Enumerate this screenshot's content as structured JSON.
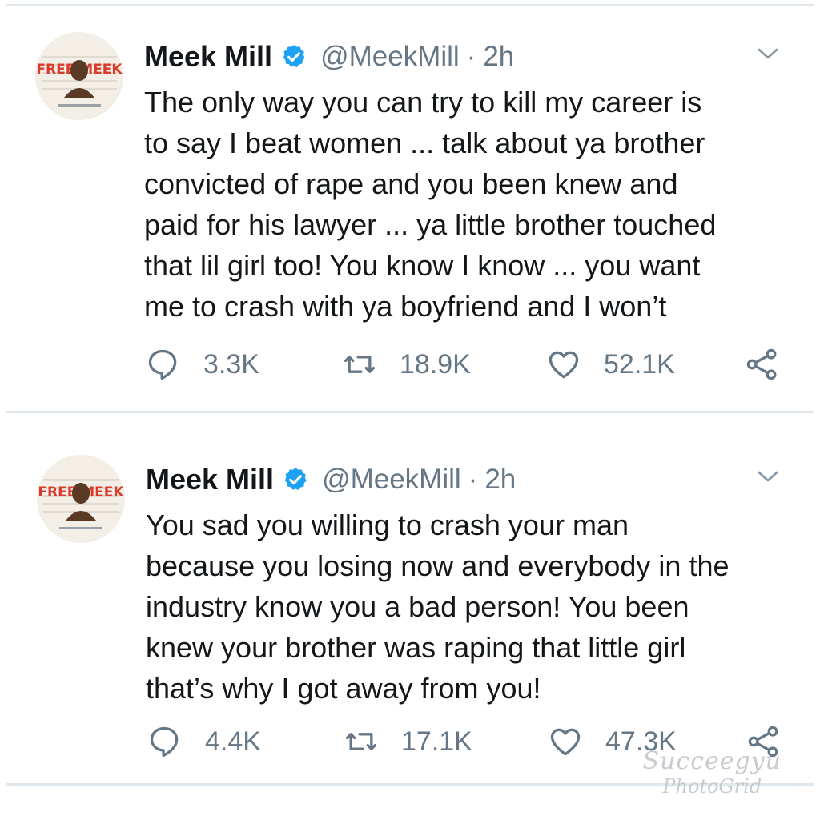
{
  "tweets": [
    {
      "name": "Meek Mill",
      "handle": "@MeekMill",
      "separator": "·",
      "time": "2h",
      "text": "The only way you can try to kill my career is\nto say I beat women ... talk about ya brother\nconvicted of rape and you been knew and\npaid for his lawyer ... ya little brother touched\nthat lil girl too! You know I know ... you want\nme to crash with ya boyfriend and I won’t",
      "replies": "3.3K",
      "retweets": "18.9K",
      "likes": "52.1K",
      "avatar_text": "FREE MEEK"
    },
    {
      "name": "Meek Mill",
      "handle": "@MeekMill",
      "separator": "·",
      "time": "2h",
      "text": "You sad you willing to crash your man\nbecause you losing now and everybody in the\nindustry know you a bad person! You been\nknew your brother was raping that little girl\nthat’s why I got away from you!",
      "replies": "4.4K",
      "retweets": "17.1K",
      "likes": "47.3K",
      "avatar_text": "FREE MEEK"
    }
  ],
  "watermark": {
    "line1": "Succeegyu",
    "line2": "PhotoGrid"
  },
  "colors": {
    "verified": "#1da1f2",
    "muted": "#657786",
    "text": "#14171a",
    "divider": "#e1e8ed"
  },
  "icons": {
    "reply": "speech-bubble-icon",
    "retweet": "retweet-icon",
    "like": "heart-icon",
    "share": "share-icon",
    "more": "chevron-down-icon",
    "verified": "verified-badge-icon"
  }
}
